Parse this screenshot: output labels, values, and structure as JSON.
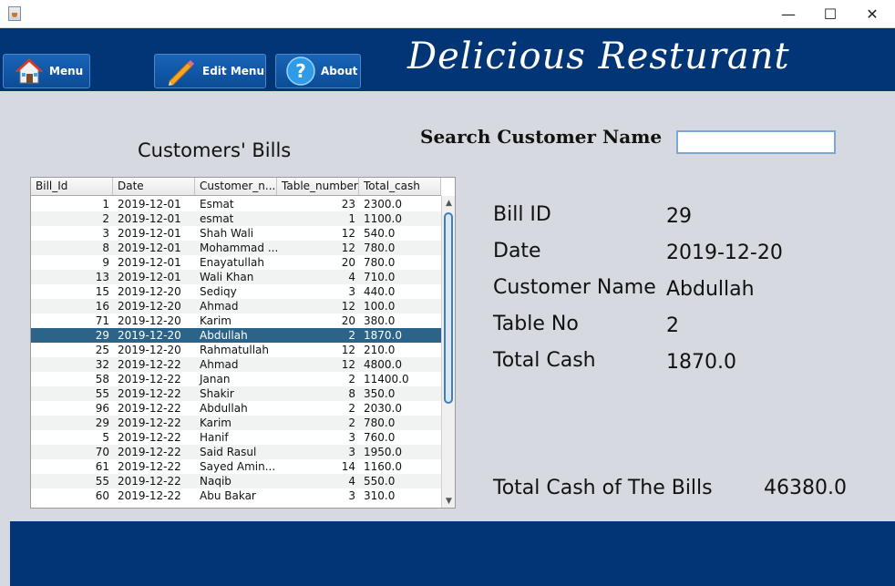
{
  "window": {
    "minimize": "—",
    "maximize": "☐",
    "close": "✕"
  },
  "toolbar": {
    "menu_label": "Menu",
    "edit_menu_label": "Edit Menu",
    "about_label": "About"
  },
  "brand": {
    "title": "Delicious Resturant"
  },
  "bills": {
    "title": "Customers' Bills",
    "columns": [
      "Bill_Id",
      "Date",
      "Customer_n...",
      "Table_number",
      "Total_cash"
    ],
    "rows": [
      [
        "1",
        "2019-12-01",
        "Esmat",
        "23",
        "2300.0"
      ],
      [
        "2",
        "2019-12-01",
        "esmat",
        "1",
        "1100.0"
      ],
      [
        "3",
        "2019-12-01",
        "Shah Wali",
        "12",
        "540.0"
      ],
      [
        "8",
        "2019-12-01",
        "Mohammad ...",
        "12",
        "780.0"
      ],
      [
        "9",
        "2019-12-01",
        "Enayatullah",
        "20",
        "780.0"
      ],
      [
        "13",
        "2019-12-01",
        "Wali Khan",
        "4",
        "710.0"
      ],
      [
        "15",
        "2019-12-20",
        "Sediqy",
        "3",
        "440.0"
      ],
      [
        "16",
        "2019-12-20",
        "Ahmad",
        "12",
        "100.0"
      ],
      [
        "71",
        "2019-12-20",
        "Karim",
        "20",
        "380.0"
      ],
      [
        "29",
        "2019-12-20",
        "Abdullah",
        "2",
        "1870.0"
      ],
      [
        "25",
        "2019-12-20",
        "Rahmatullah",
        "12",
        "210.0"
      ],
      [
        "32",
        "2019-12-22",
        "Ahmad",
        "12",
        "4800.0"
      ],
      [
        "58",
        "2019-12-22",
        "Janan",
        "2",
        "11400.0"
      ],
      [
        "55",
        "2019-12-22",
        "Shakir",
        "8",
        "350.0"
      ],
      [
        "96",
        "2019-12-22",
        "Abdullah",
        "2",
        "2030.0"
      ],
      [
        "29",
        "2019-12-22",
        "Karim",
        "2",
        "780.0"
      ],
      [
        "5",
        "2019-12-22",
        "Hanif",
        "3",
        "760.0"
      ],
      [
        "70",
        "2019-12-22",
        "Said Rasul",
        "3",
        "1950.0"
      ],
      [
        "61",
        "2019-12-22",
        "Sayed Amin...",
        "14",
        "1160.0"
      ],
      [
        "55",
        "2019-12-22",
        "Naqib",
        "4",
        "550.0"
      ],
      [
        "60",
        "2019-12-22",
        "Abu Bakar",
        "3",
        "310.0"
      ]
    ],
    "selected_index": 9
  },
  "search": {
    "label": "Search Customer Name",
    "value": ""
  },
  "details": {
    "bill_id_label": "Bill ID",
    "bill_id": "29",
    "date_label": "Date",
    "date": "2019-12-20",
    "customer_label": "Customer Name",
    "customer": "Abdullah",
    "table_label": "Table No",
    "table": "2",
    "total_label": "Total Cash",
    "total": "1870.0"
  },
  "summary": {
    "label": "Total Cash of The Bills",
    "value": "46380.0"
  },
  "colors": {
    "header_bg": "#013575",
    "selected_row": "#2b6488",
    "panel_bg": "#d6d9df"
  }
}
